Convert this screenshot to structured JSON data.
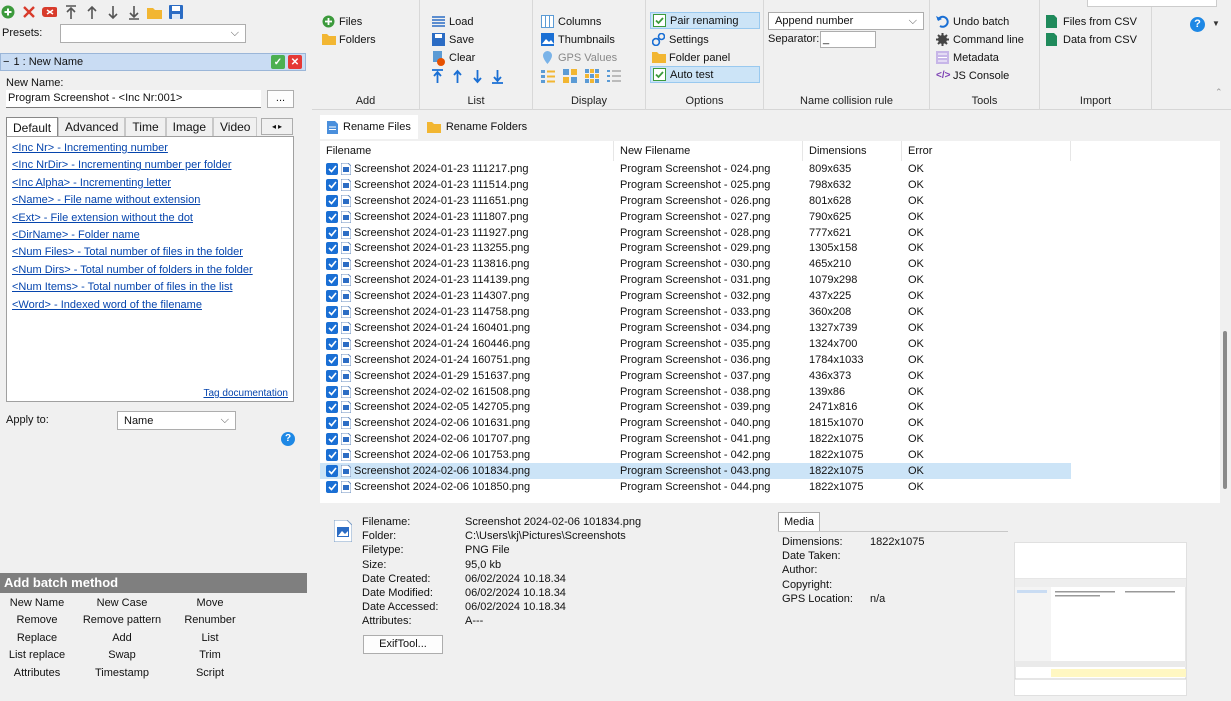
{
  "left": {
    "presets_label": "Presets:",
    "presets_value": "",
    "method_header": "1 : New Name",
    "new_name_label": "New Name:",
    "new_name_value": "Program Screenshot - <Inc Nr:001>",
    "browse_label": "...",
    "tabs": [
      "Default",
      "Advanced",
      "Time",
      "Image",
      "Video"
    ],
    "tags": [
      "<Inc Nr> - Incrementing number",
      "<Inc NrDir> - Incrementing number per folder",
      "<Inc Alpha> - Incrementing letter",
      "<Name> - File name without extension",
      "<Ext> - File extension without the dot",
      "<DirName> - Folder name",
      "<Num Files> - Total number of files in the folder",
      "<Num Dirs> - Total number of folders in the folder",
      "<Num Items> - Total number of files in the list",
      "<Word> - Indexed word of the filename"
    ],
    "tag_doc": "Tag documentation",
    "apply_to_label": "Apply to:",
    "apply_to_value": "Name",
    "add_batch_header": "Add batch method",
    "batch_methods": [
      "New Name",
      "New Case",
      "Move",
      "Remove",
      "Remove pattern",
      "Renumber",
      "Replace",
      "Add",
      "List",
      "List replace",
      "Swap",
      "Trim",
      "Attributes",
      "Timestamp",
      "Script"
    ]
  },
  "ribbon": {
    "add": {
      "label": "Add",
      "files": "Files",
      "folders": "Folders"
    },
    "list": {
      "label": "List",
      "load": "Load",
      "save": "Save",
      "clear": "Clear"
    },
    "display": {
      "label": "Display",
      "columns": "Columns",
      "thumbnails": "Thumbnails",
      "gps": "GPS Values"
    },
    "options": {
      "label": "Options",
      "pair": "Pair renaming",
      "settings": "Settings",
      "folder_panel": "Folder panel",
      "auto_test": "Auto test"
    },
    "collision": {
      "label": "Name collision rule",
      "value": "Append number",
      "separator_label": "Separator:",
      "separator_value": "_"
    },
    "tools": {
      "label": "Tools",
      "undo": "Undo batch",
      "cmd": "Command line",
      "metadata": "Metadata",
      "js": "JS Console"
    },
    "import": {
      "label": "Import",
      "files_csv": "Files from CSV",
      "data_csv": "Data from CSV"
    }
  },
  "main_tabs": [
    "Rename Files",
    "Rename Folders"
  ],
  "columns": [
    "Filename",
    "New Filename",
    "Dimensions",
    "Error"
  ],
  "rows": [
    [
      "Screenshot 2024-01-23 111217.png",
      "Program Screenshot - 024.png",
      "809x635",
      "OK"
    ],
    [
      "Screenshot 2024-01-23 111514.png",
      "Program Screenshot - 025.png",
      "798x632",
      "OK"
    ],
    [
      "Screenshot 2024-01-23 111651.png",
      "Program Screenshot - 026.png",
      "801x628",
      "OK"
    ],
    [
      "Screenshot 2024-01-23 111807.png",
      "Program Screenshot - 027.png",
      "790x625",
      "OK"
    ],
    [
      "Screenshot 2024-01-23 111927.png",
      "Program Screenshot - 028.png",
      "777x621",
      "OK"
    ],
    [
      "Screenshot 2024-01-23 113255.png",
      "Program Screenshot - 029.png",
      "1305x158",
      "OK"
    ],
    [
      "Screenshot 2024-01-23 113816.png",
      "Program Screenshot - 030.png",
      "465x210",
      "OK"
    ],
    [
      "Screenshot 2024-01-23 114139.png",
      "Program Screenshot - 031.png",
      "1079x298",
      "OK"
    ],
    [
      "Screenshot 2024-01-23 114307.png",
      "Program Screenshot - 032.png",
      "437x225",
      "OK"
    ],
    [
      "Screenshot 2024-01-23 114758.png",
      "Program Screenshot - 033.png",
      "360x208",
      "OK"
    ],
    [
      "Screenshot 2024-01-24 160401.png",
      "Program Screenshot - 034.png",
      "1327x739",
      "OK"
    ],
    [
      "Screenshot 2024-01-24 160446.png",
      "Program Screenshot - 035.png",
      "1324x700",
      "OK"
    ],
    [
      "Screenshot 2024-01-24 160751.png",
      "Program Screenshot - 036.png",
      "1784x1033",
      "OK"
    ],
    [
      "Screenshot 2024-01-29 151637.png",
      "Program Screenshot - 037.png",
      "436x373",
      "OK"
    ],
    [
      "Screenshot 2024-02-02 161508.png",
      "Program Screenshot - 038.png",
      "139x86",
      "OK"
    ],
    [
      "Screenshot 2024-02-05 142705.png",
      "Program Screenshot - 039.png",
      "2471x816",
      "OK"
    ],
    [
      "Screenshot 2024-02-06 101631.png",
      "Program Screenshot - 040.png",
      "1815x1070",
      "OK"
    ],
    [
      "Screenshot 2024-02-06 101707.png",
      "Program Screenshot - 041.png",
      "1822x1075",
      "OK"
    ],
    [
      "Screenshot 2024-02-06 101753.png",
      "Program Screenshot - 042.png",
      "1822x1075",
      "OK"
    ],
    [
      "Screenshot 2024-02-06 101834.png",
      "Program Screenshot - 043.png",
      "1822x1075",
      "OK"
    ],
    [
      "Screenshot 2024-02-06 101850.png",
      "Program Screenshot - 044.png",
      "1822x1075",
      "OK"
    ]
  ],
  "selected_row": 19,
  "info": {
    "labels": [
      "Filename:",
      "Folder:",
      "Filetype:",
      "Size:",
      "Date Created:",
      "Date Modified:",
      "Date Accessed:",
      "Attributes:"
    ],
    "values": [
      "Screenshot 2024-02-06 101834.png",
      "C:\\Users\\kj\\Pictures\\Screenshots",
      "PNG File",
      "95,0 kb",
      "06/02/2024 10.18.34",
      "06/02/2024 10.18.34",
      "06/02/2024 10.18.34",
      "A---"
    ],
    "exiftool": "ExifTool...",
    "media_tab": "Media",
    "media_labels": [
      "Dimensions:",
      "Date Taken:",
      "Author:",
      "Copyright:",
      "GPS Location:"
    ],
    "media_values": [
      "1822x1075",
      "",
      "",
      "",
      "n/a"
    ]
  },
  "colors": {
    "accent": "#1a6fd4",
    "selection": "#cce4f7",
    "header": "#c9dcf3",
    "link": "#0645ad"
  }
}
